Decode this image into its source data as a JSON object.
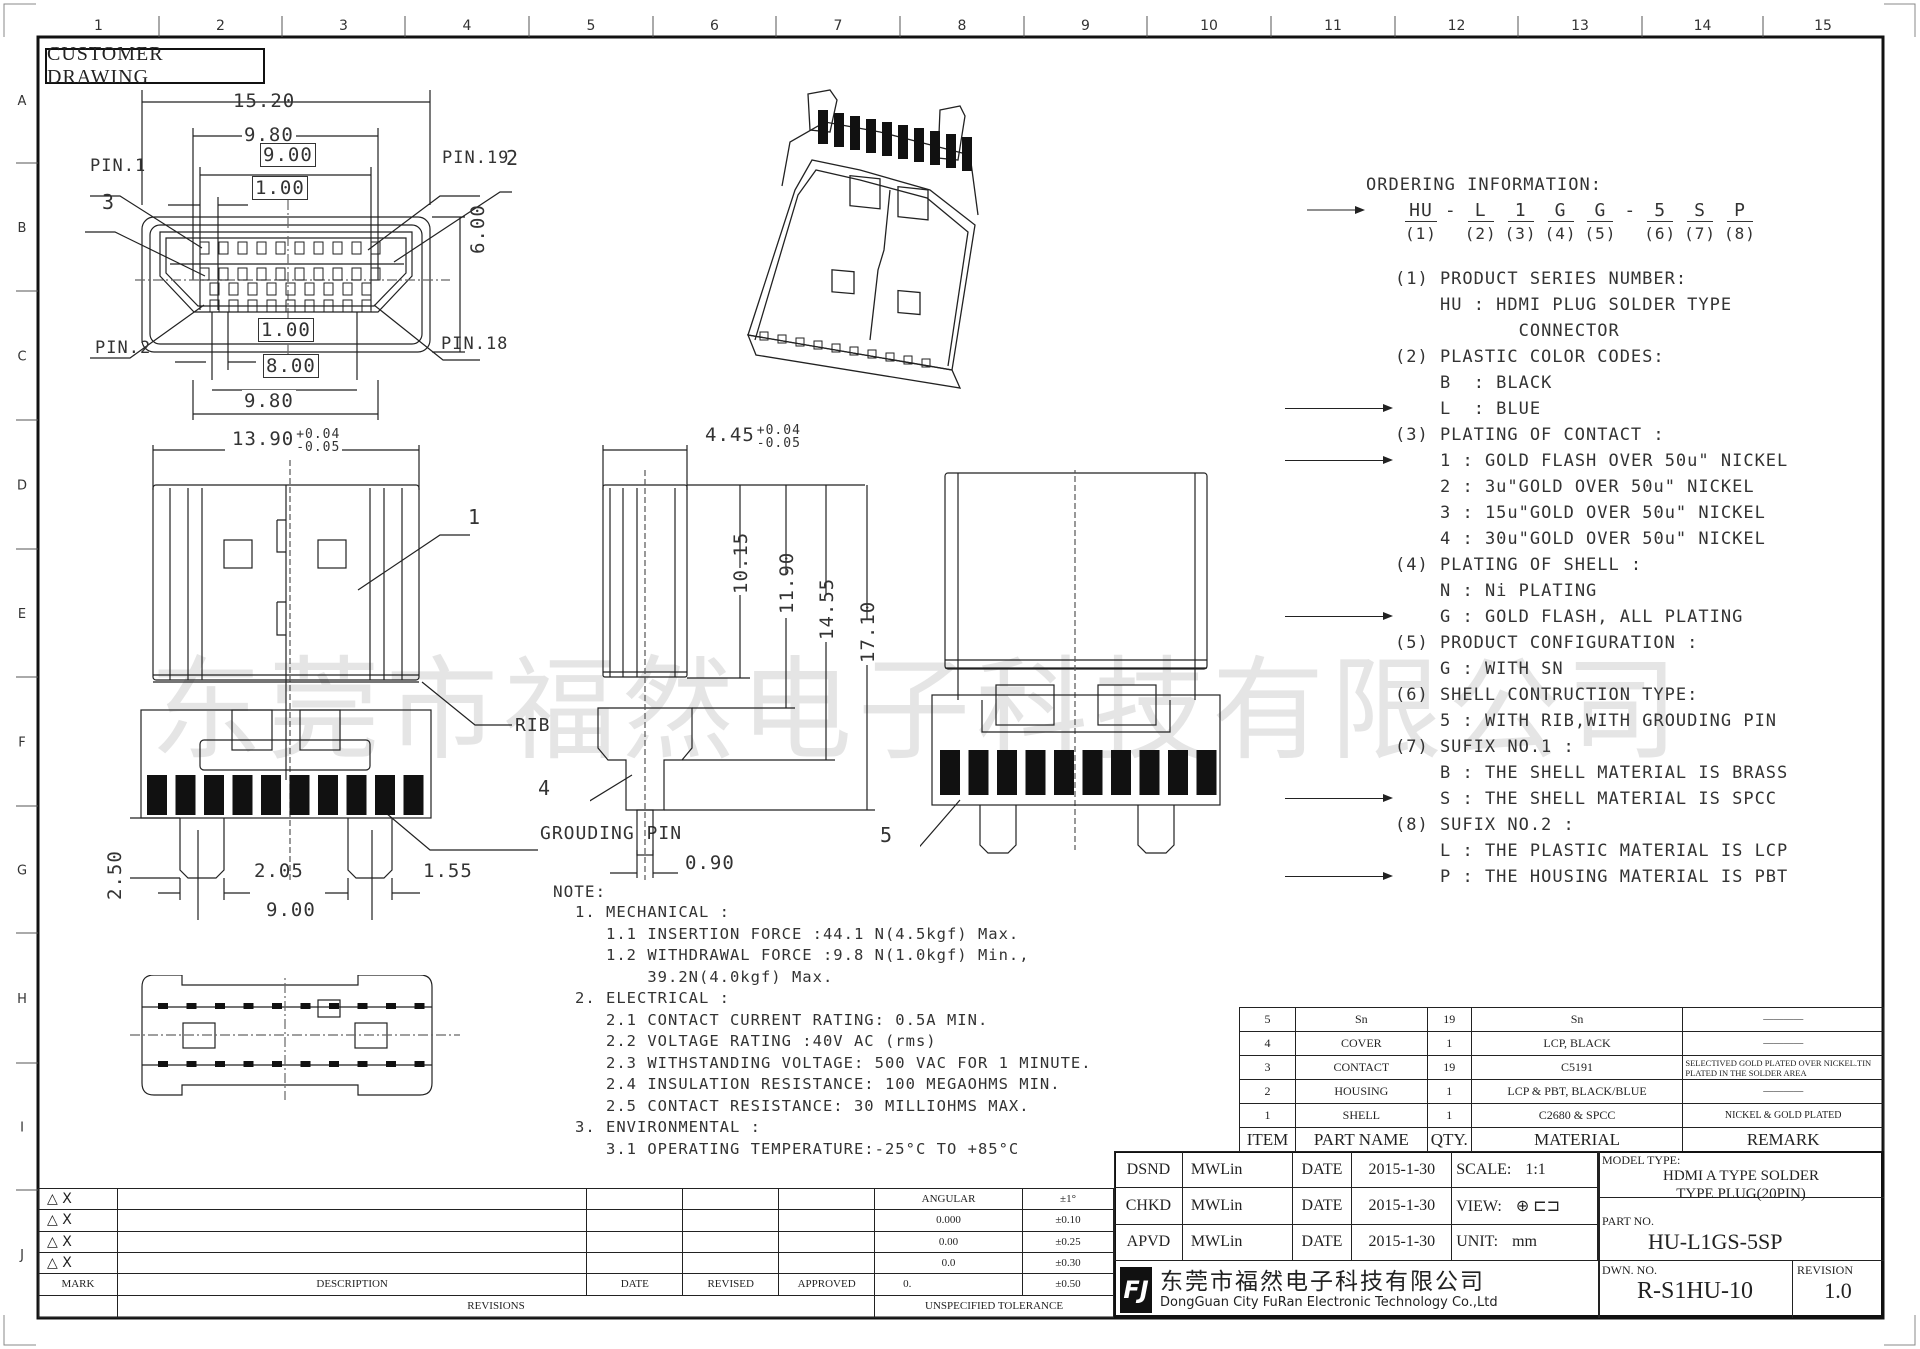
{
  "drawing": {
    "title_box": "CUSTOMER DRAWING",
    "column_labels": [
      "1",
      "2",
      "3",
      "4",
      "5",
      "6",
      "7",
      "8",
      "9",
      "10",
      "11",
      "12",
      "13",
      "14",
      "15"
    ],
    "row_labels": [
      "A",
      "B",
      "C",
      "D",
      "E",
      "F",
      "G",
      "H",
      "I",
      "J"
    ],
    "watermark": "东莞市福然电子科技有限公司"
  },
  "top_view": {
    "dims": {
      "overall_width": "15.20",
      "outer_pitch": "9.80",
      "pin_span_top": "9.00",
      "pin_pitch_top": "1.00",
      "height": "6.00",
      "pin_pitch_bottom": "1.00",
      "pin_span_bottom": "8.00",
      "outer_pitch_bottom": "9.80"
    },
    "labels": {
      "pin1": "PIN.1",
      "pin19": "PIN.19",
      "pin2": "PIN.2",
      "pin18": "PIN.18",
      "callout_2": "2",
      "callout_3": "3"
    }
  },
  "front_view": {
    "width_dim": "13.90",
    "width_tol_plus": "+0.04",
    "width_tol_minus": "-0.05",
    "callout_1": "1",
    "rib_label": "RIB",
    "grounding_pin_label": "GROUDING PIN",
    "dims": {
      "pin_height": "2.50",
      "pin_offset": "2.05",
      "pin_width": "1.55",
      "pin_span": "9.00"
    }
  },
  "side_view": {
    "width_dim": "4.45",
    "width_tol_plus": "+0.04",
    "width_tol_minus": "-0.05",
    "dims": {
      "d1": "10.15",
      "d2": "11.90",
      "d3": "14.55",
      "d4": "17.10",
      "pin_thickness": "0.90"
    },
    "callout_4": "4"
  },
  "back_view": {
    "callout_5": "5"
  },
  "ordering": {
    "title": "ORDERING INFORMATION:",
    "code_parts": [
      {
        "code": "HU",
        "idx": "(1)"
      },
      {
        "code": "L",
        "idx": "(2)"
      },
      {
        "code": "1",
        "idx": "(3)"
      },
      {
        "code": "G",
        "idx": "(4)"
      },
      {
        "code": "G",
        "idx": "(5)"
      },
      {
        "code": "5",
        "idx": "(6)"
      },
      {
        "code": "S",
        "idx": "(7)"
      },
      {
        "code": "P",
        "idx": "(8)"
      }
    ],
    "dash": "-",
    "sections": [
      {
        "heading": "(1) PRODUCT SERIES NUMBER:",
        "options": [
          {
            "text": "HU : HDMI PLUG SOLDER TYPE",
            "selected": false
          },
          {
            "text": "       CONNECTOR",
            "selected": false
          }
        ]
      },
      {
        "heading": "(2) PLASTIC COLOR CODES:",
        "options": [
          {
            "text": "B  : BLACK",
            "selected": false
          },
          {
            "text": "L  : BLUE",
            "selected": true
          }
        ]
      },
      {
        "heading": "(3) PLATING OF CONTACT :",
        "options": [
          {
            "text": "1 : GOLD FLASH OVER 50u\" NICKEL",
            "selected": true
          },
          {
            "text": "2 : 3u\"GOLD OVER 50u\" NICKEL",
            "selected": false
          },
          {
            "text": "3 : 15u\"GOLD OVER 50u\" NICKEL",
            "selected": false
          },
          {
            "text": "4 : 30u\"GOLD OVER 50u\" NICKEL",
            "selected": false
          }
        ]
      },
      {
        "heading": "(4) PLATING OF SHELL :",
        "options": [
          {
            "text": "N : Ni PLATING",
            "selected": false
          },
          {
            "text": "G : GOLD FLASH, ALL PLATING",
            "selected": true
          }
        ]
      },
      {
        "heading": "(5) PRODUCT CONFIGURATION :",
        "options": [
          {
            "text": "G : WITH SN",
            "selected": false
          }
        ]
      },
      {
        "heading": "(6) SHELL CONTRUCTION TYPE:",
        "options": [
          {
            "text": "5 : WITH RIB,WITH GROUDING PIN",
            "selected": false
          }
        ]
      },
      {
        "heading": "(7) SUFIX NO.1 :",
        "options": [
          {
            "text": "B : THE SHELL MATERIAL IS BRASS",
            "selected": false
          },
          {
            "text": "S : THE SHELL MATERIAL IS SPCC",
            "selected": true
          }
        ]
      },
      {
        "heading": "(8) SUFIX NO.2 :",
        "options": [
          {
            "text": "L : THE PLASTIC MATERIAL IS LCP",
            "selected": false
          },
          {
            "text": "P : THE HOUSING MATERIAL IS PBT",
            "selected": true
          }
        ]
      }
    ]
  },
  "notes": {
    "title": "NOTE:",
    "lines": [
      "1. MECHANICAL :",
      "   1.1 INSERTION FORCE :44.1 N(4.5kgf) Max.",
      "   1.2 WITHDRAWAL FORCE :9.8 N(1.0kgf) Min.,",
      "       39.2N(4.0kgf) Max.",
      "2. ELECTRICAL :",
      "   2.1 CONTACT CURRENT RATING: 0.5A MIN.",
      "   2.2 VOLTAGE RATING :40V AC (rms)",
      "   2.3 WITHSTANDING VOLTAGE: 500 VAC FOR 1 MINUTE.",
      "   2.4 INSULATION RESISTANCE: 100 MEGAOHMS MIN.",
      "   2.5 CONTACT RESISTANCE: 30 MILLIOHMS MAX.",
      "3. ENVIRONMENTAL :",
      "   3.1 OPERATING TEMPERATURE:-25°C TO +85°C"
    ]
  },
  "bom": {
    "headers": [
      "ITEM",
      "PART  NAME",
      "QTY.",
      "MATERIAL",
      "REMARK"
    ],
    "rows": [
      [
        "5",
        "Sn",
        "19",
        "Sn",
        "————"
      ],
      [
        "4",
        "COVER",
        "1",
        "LCP, BLACK",
        "————"
      ],
      [
        "3",
        "CONTACT",
        "19",
        "C5191",
        "SELECTIVED GOLD PLATED OVER NICKEL.TIN PLATED IN THE SOLDER AREA"
      ],
      [
        "2",
        "HOUSING",
        "1",
        "LCP & PBT, BLACK/BLUE",
        "————"
      ],
      [
        "1",
        "SHELL",
        "1",
        "C2680 & SPCC",
        "NICKEL & GOLD PLATED"
      ]
    ]
  },
  "title_block": {
    "rows": [
      {
        "role": "DSND",
        "name": "MWLin",
        "date_label": "DATE",
        "date": "2015-1-30"
      },
      {
        "role": "CHKD",
        "name": "MWLin",
        "date_label": "DATE",
        "date": "2015-1-30"
      },
      {
        "role": "APVD",
        "name": "MWLin",
        "date_label": "DATE",
        "date": "2015-1-30"
      }
    ],
    "scale_label": "SCALE:",
    "scale": "1:1",
    "view_label": "VIEW:",
    "unit_label": "UNIT:",
    "unit": "mm",
    "model_type_label": "MODEL TYPE:",
    "model_type_line1": "HDMI A TYPE SOLDER",
    "model_type_line2": "TYPE PLUG(20PIN)",
    "part_no_label": "PART NO.",
    "part_no": "HU-L1GS-5SP",
    "company_cn": "东莞市福然电子科技有限公司",
    "company_en": "DongGuan City FuRan Electronic Technology Co.,Ltd",
    "logo_text": "FJ",
    "dwn_no_label": "DWN. NO.",
    "dwn_no": "R-S1HU-10",
    "revision_label": "REVISION",
    "revision": "1.0"
  },
  "revisions": {
    "marks": [
      "△ X",
      "△ X",
      "△ X",
      "△ X"
    ],
    "headers": {
      "mark": "MARK",
      "description": "DESCRIPTION",
      "date": "DATE",
      "revised": "REVISED",
      "approved": "APPROVED"
    },
    "footer": "REVISIONS",
    "tolerance": {
      "rows": [
        [
          "ANGULAR",
          "±1°"
        ],
        [
          "0.000",
          "±0.10"
        ],
        [
          "0.00",
          "±0.25"
        ],
        [
          "0.0",
          "±0.30"
        ],
        [
          "0.",
          "±0.50"
        ]
      ],
      "footer": "UNSPECIFIED TOLERANCE"
    }
  }
}
